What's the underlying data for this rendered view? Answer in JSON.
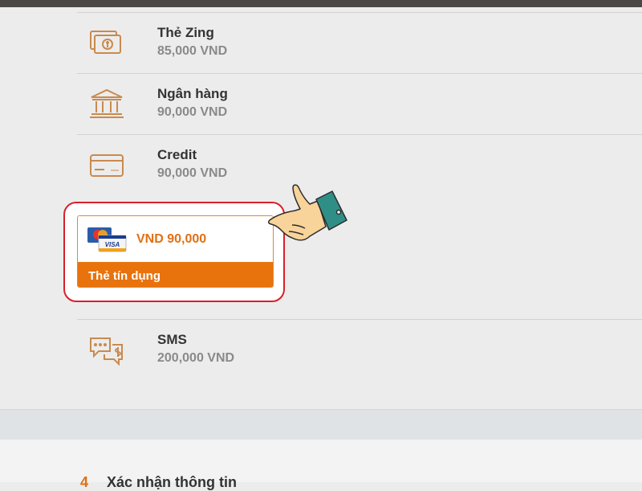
{
  "payment_methods": [
    {
      "name": "Thẻ Zing",
      "price": "85,000 VND",
      "icon": "zing-card-icon"
    },
    {
      "name": "Ngân hàng",
      "price": "90,000 VND",
      "icon": "bank-icon"
    },
    {
      "name": "Credit",
      "price": "90,000 VND",
      "icon": "credit-card-icon"
    },
    {
      "name": "SMS",
      "price": "200,000 VND",
      "icon": "sms-icon"
    }
  ],
  "selected_card": {
    "amount": "VND 90,000",
    "label": "Thẻ tín dụng",
    "logo": "mastercard-visa-logo"
  },
  "pointer": "pointing-hand-icon",
  "next_step": {
    "number": "4",
    "title": "Xác nhận thông tin"
  },
  "colors": {
    "accent": "#e8720c",
    "highlight_border": "#d8202a",
    "icon_stroke": "#c98a4e"
  }
}
